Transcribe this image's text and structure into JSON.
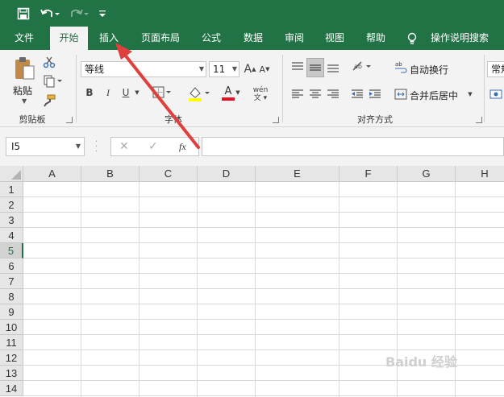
{
  "quick_access": {
    "save_icon": "save-icon",
    "undo_icon": "undo-icon",
    "redo_icon": "redo-icon",
    "customize_icon": "customize-icon"
  },
  "tabs": [
    {
      "label": "文件"
    },
    {
      "label": "开始"
    },
    {
      "label": "插入"
    },
    {
      "label": "页面布局"
    },
    {
      "label": "公式"
    },
    {
      "label": "数据"
    },
    {
      "label": "审阅"
    },
    {
      "label": "视图"
    },
    {
      "label": "帮助"
    }
  ],
  "tell_me": "操作说明搜索",
  "clipboard": {
    "paste_label": "粘贴",
    "group_label": "剪贴板"
  },
  "font": {
    "name": "等线",
    "size": "11",
    "group_label": "字体",
    "bold": "B",
    "italic": "I",
    "underline": "U",
    "grow": "A",
    "shrink": "A",
    "font_color_letter": "A",
    "phonetic": "wén"
  },
  "alignment": {
    "wrap_label": "自动换行",
    "merge_label": "合并后居中",
    "group_label": "对齐方式"
  },
  "number": {
    "format": "常规"
  },
  "formula_bar": {
    "name_box": "I5",
    "fx": "fx",
    "cancel": "✕",
    "enter": "✓"
  },
  "columns": [
    "A",
    "B",
    "C",
    "D",
    "E",
    "F",
    "G",
    "H"
  ],
  "rows": [
    "1",
    "2",
    "3",
    "4",
    "5",
    "6",
    "7",
    "8",
    "9",
    "10",
    "11",
    "12",
    "13",
    "14"
  ],
  "selected_row": "5",
  "colors": {
    "accent": "#217346",
    "arrow": "#e0403d",
    "font_color_bar": "#e81123",
    "highlight_bar": "#ffff00"
  },
  "watermark": "Baidu 经验"
}
